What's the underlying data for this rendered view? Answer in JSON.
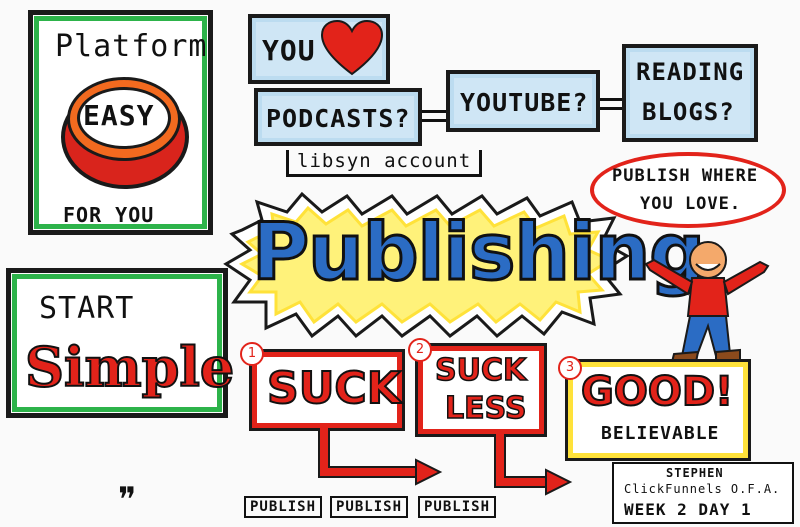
{
  "platform": {
    "title": "Platform",
    "button": "EASY",
    "footer": "FOR YOU"
  },
  "you_love": {
    "you": "YOU"
  },
  "podcasts": {
    "label": "PODCASTS?",
    "account": "libsyn account"
  },
  "youtube": {
    "label": "YOUTUBE?"
  },
  "reading": {
    "line1": "READING",
    "line2": "BLOGS?"
  },
  "publish_where": {
    "line1": "PUBLISH WHERE",
    "line2": "YOU LOVE."
  },
  "center": {
    "title": "Publishing"
  },
  "start": {
    "line1": "START",
    "line2": "Simple"
  },
  "steps": [
    {
      "num": "1",
      "line1": "SUCK",
      "line2": ""
    },
    {
      "num": "2",
      "line1": "SUCK",
      "line2": "LESS"
    },
    {
      "num": "3",
      "line1": "GOOD!",
      "line2": "BELIEVABLE"
    }
  ],
  "publish_tags": [
    "PUBLISH",
    "PUBLISH",
    "PUBLISH"
  ],
  "credit": {
    "line1": "STEPHEN",
    "line2": "ClickFunnels O.F.A.",
    "line3": "WEEK 2 DAY 1"
  },
  "quote_mark": "❞",
  "colors": {
    "green": "#2db34a",
    "red": "#e2231a",
    "blue": "#2b6cc4",
    "yellow": "#ffe23a",
    "lightblue": "#cfe6f5"
  }
}
